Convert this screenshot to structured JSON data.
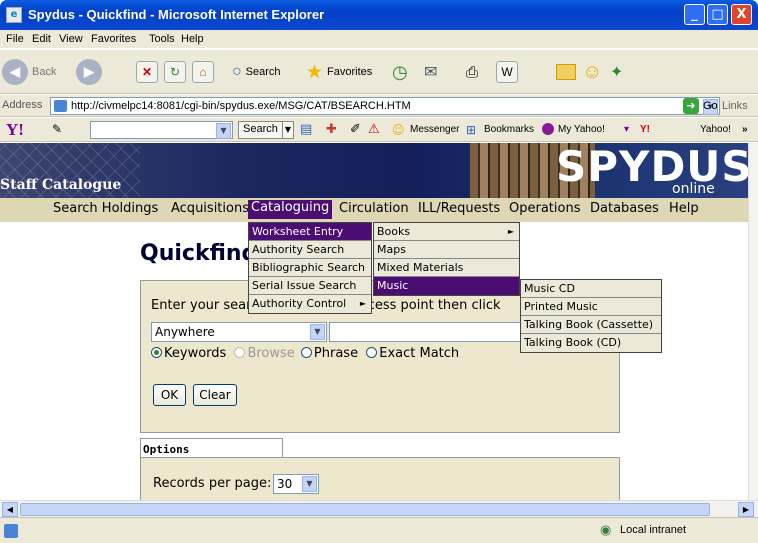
{
  "window": {
    "title": "Spydus - Quickfind - Microsoft Internet Explorer",
    "min": "_",
    "max": "□",
    "close": "X",
    "app_icon": "ie-icon"
  },
  "menubar": [
    "File",
    "Edit",
    "View",
    "Favorites",
    "Tools",
    "Help"
  ],
  "toolbar": {
    "back": "Back",
    "search": "Search",
    "favorites": "Favorites"
  },
  "address": {
    "label": "Address",
    "url": "http://civmelpc14:8081/cgi-bin/spydus.exe/MSG/CAT/BSEARCH.HTM",
    "go": "Go",
    "links": "Links"
  },
  "yahoo": {
    "logo": "Y!",
    "search_btn": "Search",
    "messenger": "Messenger",
    "bookmarks": "Bookmarks",
    "my_yahoo": "My Yahoo!",
    "yahoo": "Yahoo!"
  },
  "banner": {
    "staff": "Staff Catalogue",
    "logo": "SPYDUS",
    "online": "online"
  },
  "nav": [
    "Search Holdings",
    "Acquisitions",
    "Cataloguing",
    "Circulation",
    "ILL/Requests",
    "Operations",
    "Databases",
    "Help"
  ],
  "page": {
    "title": "Quickfind",
    "enter_label": "Enter your search term, select access point then click"
  },
  "search": {
    "access_point": "Anywhere",
    "term": "",
    "radios": [
      "Keywords",
      "Browse",
      "Phrase",
      "Exact Match"
    ],
    "ok": "OK",
    "clear": "Clear"
  },
  "options": {
    "heading": "Options",
    "rpp_label": "Records per page:",
    "rpp_value": "30"
  },
  "menu_cataloguing": [
    "Worksheet Entry",
    "Authority Search",
    "Bibliographic Search",
    "Serial Issue Search",
    "Authority Control"
  ],
  "menu_worksheet": [
    "Books",
    "Maps",
    "Mixed Materials",
    "Music"
  ],
  "menu_music": [
    "Music CD",
    "Printed Music",
    "Talking Book (Cassette)",
    "Talking Book (CD)"
  ],
  "status": {
    "zone": "Local intranet"
  },
  "colors": {
    "nav_bg": "#ddd7b6",
    "highlight": "#4a0d72",
    "panel": "#ede8cd",
    "title_blue": "#0a5be0"
  }
}
